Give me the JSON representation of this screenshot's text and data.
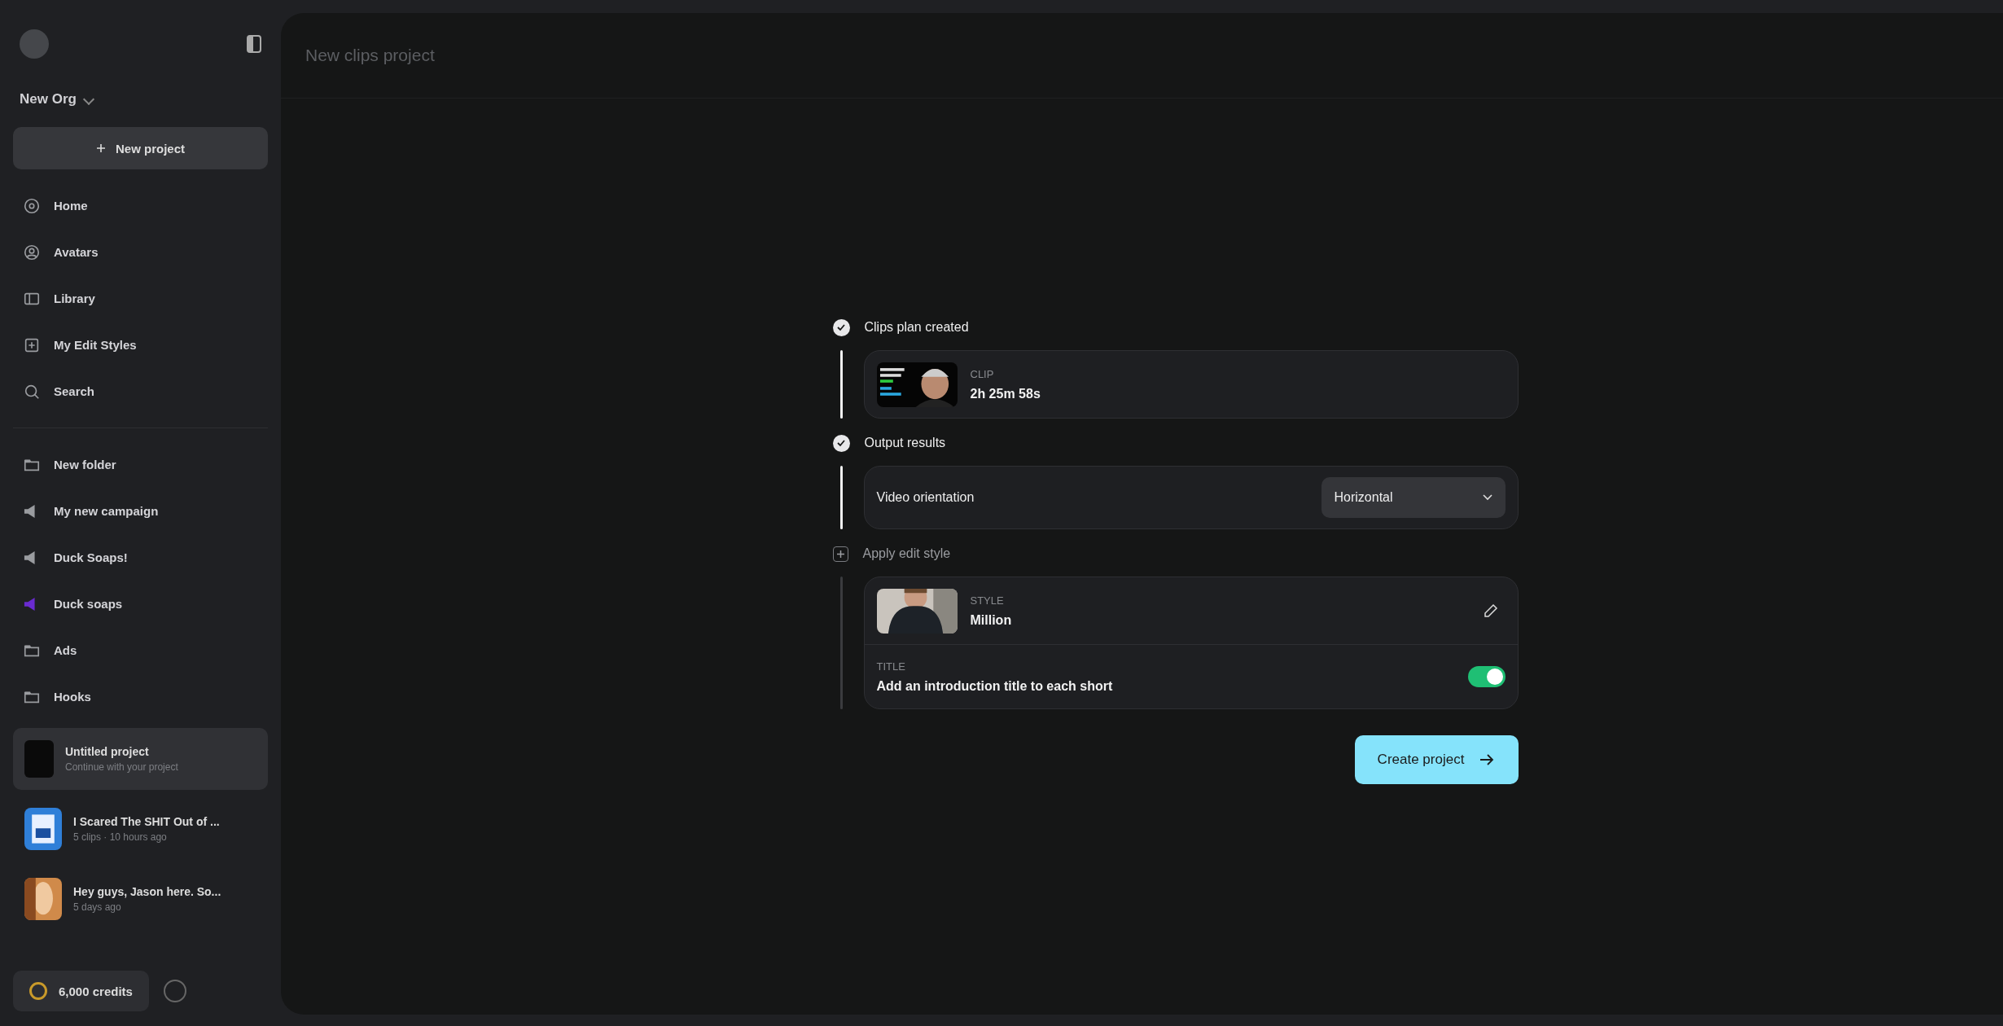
{
  "sidebar": {
    "org": "New Org",
    "new_project": "New project",
    "nav": [
      {
        "label": "Home",
        "kind": "home"
      },
      {
        "label": "Avatars",
        "kind": "avatar"
      },
      {
        "label": "Library",
        "kind": "library"
      },
      {
        "label": "My Edit Styles",
        "kind": "styles"
      },
      {
        "label": "Search",
        "kind": "search"
      }
    ],
    "folders": [
      {
        "label": "New folder",
        "kind": "folder",
        "color": "#9a9ca0"
      },
      {
        "label": "My new campaign",
        "kind": "campaign",
        "color": "#9a9ca0"
      },
      {
        "label": "Duck Soaps!",
        "kind": "campaign",
        "color": "#9a9ca0"
      },
      {
        "label": "Duck soaps",
        "kind": "campaign",
        "color": "#6a2bd0"
      },
      {
        "label": "Ads",
        "kind": "folder",
        "color": "#9a9ca0"
      },
      {
        "label": "Hooks",
        "kind": "folder",
        "color": "#9a9ca0"
      }
    ],
    "projects": [
      {
        "title": "Untitled project",
        "subtitle": "Continue with your project",
        "kind": "draft",
        "selected": true
      },
      {
        "title": "I Scared The SHIT Out of ...",
        "subtitle": "5 clips · 10 hours ago",
        "kind": "video",
        "selected": false
      },
      {
        "title": "Hey guys, Jason here. So...",
        "subtitle": "5 days ago",
        "kind": "video",
        "selected": false
      }
    ],
    "credits": "6,000 credits"
  },
  "header": {
    "title": "New clips project"
  },
  "steps": [
    {
      "label": "Clips plan created",
      "done": true,
      "kind": "clip",
      "caption": "CLIP",
      "value": "2h 25m 58s"
    },
    {
      "label": "Output results",
      "done": true,
      "kind": "orientation",
      "field_label": "Video orientation",
      "value": "Horizontal"
    },
    {
      "label": "Apply edit style",
      "done": false,
      "kind": "style",
      "caption": "STYLE",
      "value": "Million",
      "title_caption": "TITLE",
      "title_text": "Add an introduction title to each short",
      "title_on": true
    }
  ],
  "create_button": "Create project"
}
